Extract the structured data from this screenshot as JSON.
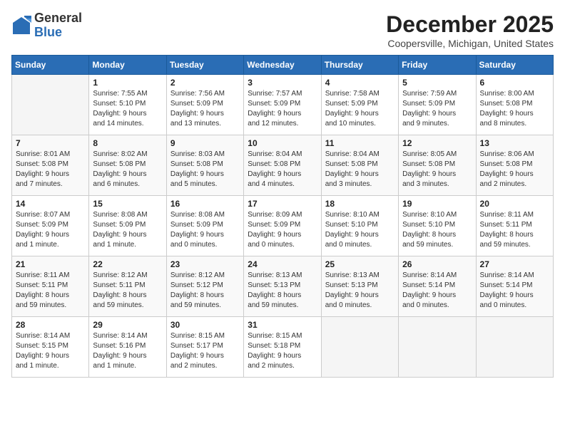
{
  "logo": {
    "general": "General",
    "blue": "Blue"
  },
  "header": {
    "title": "December 2025",
    "subtitle": "Coopersville, Michigan, United States"
  },
  "weekdays": [
    "Sunday",
    "Monday",
    "Tuesday",
    "Wednesday",
    "Thursday",
    "Friday",
    "Saturday"
  ],
  "weeks": [
    [
      {
        "day": "",
        "info": ""
      },
      {
        "day": "1",
        "info": "Sunrise: 7:55 AM\nSunset: 5:10 PM\nDaylight: 9 hours\nand 14 minutes."
      },
      {
        "day": "2",
        "info": "Sunrise: 7:56 AM\nSunset: 5:09 PM\nDaylight: 9 hours\nand 13 minutes."
      },
      {
        "day": "3",
        "info": "Sunrise: 7:57 AM\nSunset: 5:09 PM\nDaylight: 9 hours\nand 12 minutes."
      },
      {
        "day": "4",
        "info": "Sunrise: 7:58 AM\nSunset: 5:09 PM\nDaylight: 9 hours\nand 10 minutes."
      },
      {
        "day": "5",
        "info": "Sunrise: 7:59 AM\nSunset: 5:09 PM\nDaylight: 9 hours\nand 9 minutes."
      },
      {
        "day": "6",
        "info": "Sunrise: 8:00 AM\nSunset: 5:08 PM\nDaylight: 9 hours\nand 8 minutes."
      }
    ],
    [
      {
        "day": "7",
        "info": "Sunrise: 8:01 AM\nSunset: 5:08 PM\nDaylight: 9 hours\nand 7 minutes."
      },
      {
        "day": "8",
        "info": "Sunrise: 8:02 AM\nSunset: 5:08 PM\nDaylight: 9 hours\nand 6 minutes."
      },
      {
        "day": "9",
        "info": "Sunrise: 8:03 AM\nSunset: 5:08 PM\nDaylight: 9 hours\nand 5 minutes."
      },
      {
        "day": "10",
        "info": "Sunrise: 8:04 AM\nSunset: 5:08 PM\nDaylight: 9 hours\nand 4 minutes."
      },
      {
        "day": "11",
        "info": "Sunrise: 8:04 AM\nSunset: 5:08 PM\nDaylight: 9 hours\nand 3 minutes."
      },
      {
        "day": "12",
        "info": "Sunrise: 8:05 AM\nSunset: 5:08 PM\nDaylight: 9 hours\nand 3 minutes."
      },
      {
        "day": "13",
        "info": "Sunrise: 8:06 AM\nSunset: 5:08 PM\nDaylight: 9 hours\nand 2 minutes."
      }
    ],
    [
      {
        "day": "14",
        "info": "Sunrise: 8:07 AM\nSunset: 5:09 PM\nDaylight: 9 hours\nand 1 minute."
      },
      {
        "day": "15",
        "info": "Sunrise: 8:08 AM\nSunset: 5:09 PM\nDaylight: 9 hours\nand 1 minute."
      },
      {
        "day": "16",
        "info": "Sunrise: 8:08 AM\nSunset: 5:09 PM\nDaylight: 9 hours\nand 0 minutes."
      },
      {
        "day": "17",
        "info": "Sunrise: 8:09 AM\nSunset: 5:09 PM\nDaylight: 9 hours\nand 0 minutes."
      },
      {
        "day": "18",
        "info": "Sunrise: 8:10 AM\nSunset: 5:10 PM\nDaylight: 9 hours\nand 0 minutes."
      },
      {
        "day": "19",
        "info": "Sunrise: 8:10 AM\nSunset: 5:10 PM\nDaylight: 8 hours\nand 59 minutes."
      },
      {
        "day": "20",
        "info": "Sunrise: 8:11 AM\nSunset: 5:11 PM\nDaylight: 8 hours\nand 59 minutes."
      }
    ],
    [
      {
        "day": "21",
        "info": "Sunrise: 8:11 AM\nSunset: 5:11 PM\nDaylight: 8 hours\nand 59 minutes."
      },
      {
        "day": "22",
        "info": "Sunrise: 8:12 AM\nSunset: 5:11 PM\nDaylight: 8 hours\nand 59 minutes."
      },
      {
        "day": "23",
        "info": "Sunrise: 8:12 AM\nSunset: 5:12 PM\nDaylight: 8 hours\nand 59 minutes."
      },
      {
        "day": "24",
        "info": "Sunrise: 8:13 AM\nSunset: 5:13 PM\nDaylight: 8 hours\nand 59 minutes."
      },
      {
        "day": "25",
        "info": "Sunrise: 8:13 AM\nSunset: 5:13 PM\nDaylight: 9 hours\nand 0 minutes."
      },
      {
        "day": "26",
        "info": "Sunrise: 8:14 AM\nSunset: 5:14 PM\nDaylight: 9 hours\nand 0 minutes."
      },
      {
        "day": "27",
        "info": "Sunrise: 8:14 AM\nSunset: 5:14 PM\nDaylight: 9 hours\nand 0 minutes."
      }
    ],
    [
      {
        "day": "28",
        "info": "Sunrise: 8:14 AM\nSunset: 5:15 PM\nDaylight: 9 hours\nand 1 minute."
      },
      {
        "day": "29",
        "info": "Sunrise: 8:14 AM\nSunset: 5:16 PM\nDaylight: 9 hours\nand 1 minute."
      },
      {
        "day": "30",
        "info": "Sunrise: 8:15 AM\nSunset: 5:17 PM\nDaylight: 9 hours\nand 2 minutes."
      },
      {
        "day": "31",
        "info": "Sunrise: 8:15 AM\nSunset: 5:18 PM\nDaylight: 9 hours\nand 2 minutes."
      },
      {
        "day": "",
        "info": ""
      },
      {
        "day": "",
        "info": ""
      },
      {
        "day": "",
        "info": ""
      }
    ]
  ]
}
